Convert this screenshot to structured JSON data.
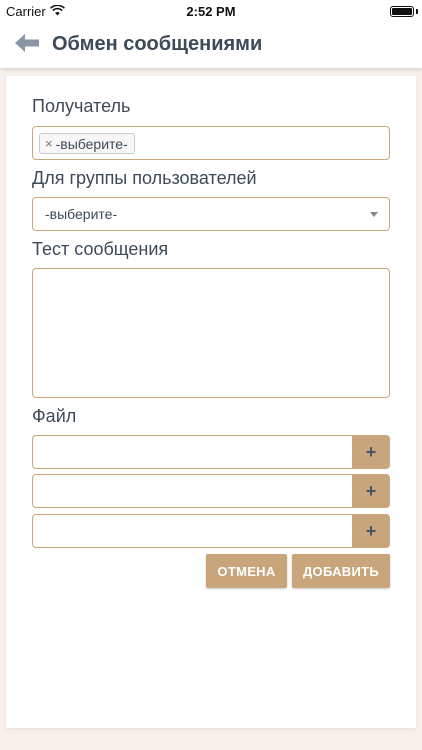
{
  "status_bar": {
    "carrier": "Carrier",
    "time": "2:52 PM",
    "wifi_icon": "wifi-icon",
    "battery_icon": "battery-icon"
  },
  "header": {
    "title": "Обмен сообщениями",
    "back_icon": "arrow-left-icon"
  },
  "form": {
    "recipient_label": "Получатель",
    "recipient_tag_remove": "×",
    "recipient_tag": "-выберите-",
    "group_label": "Для группы пользователей",
    "group_value": "-выберите-",
    "message_label": "Тест сообщения",
    "message_value": "",
    "file_label": "Файл",
    "file_add_symbol": "+",
    "cancel_button": "ОТМЕНА",
    "add_button": "ДОБАВИТЬ"
  },
  "colors": {
    "accent": "#c8a57a",
    "border": "#c9a97a",
    "text": "#3d4a59",
    "background": "#f6f1ea"
  }
}
